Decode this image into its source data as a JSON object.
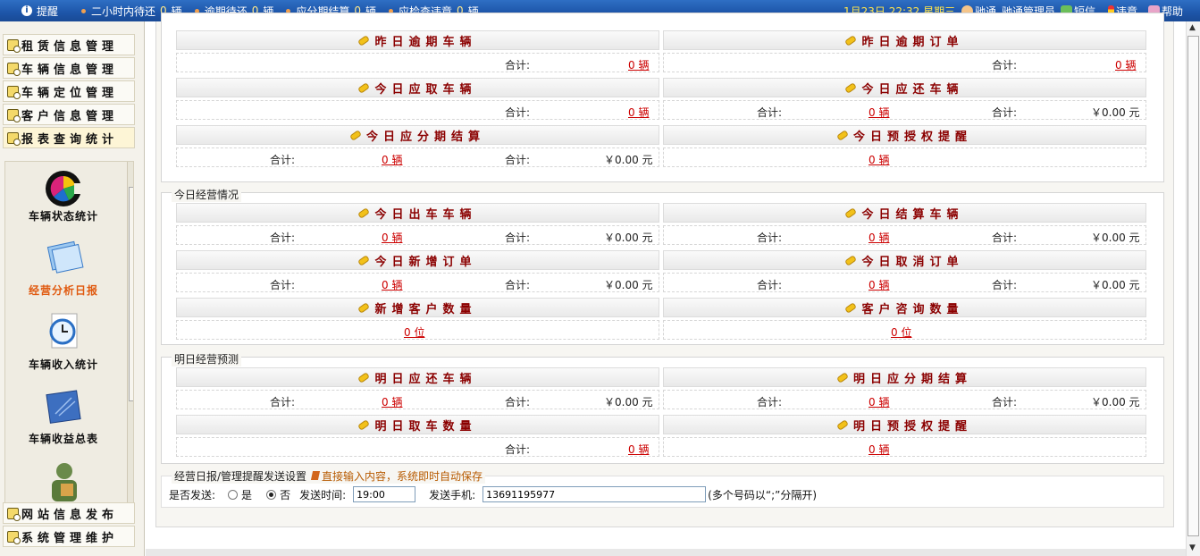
{
  "topbar": {
    "remind": "提醒",
    "items": [
      {
        "label": "二小时内待还",
        "count": "0",
        "unit": "辆"
      },
      {
        "label": "逾期待还",
        "count": "0",
        "unit": "辆"
      },
      {
        "label": "应分期结算",
        "count": "0",
        "unit": "辆"
      },
      {
        "label": "应检查违章",
        "count": "0",
        "unit": "辆"
      }
    ],
    "date": "1月23日  22:32  星期三",
    "company": "驰通",
    "user": "驰通管理员",
    "sms": "短信",
    "violation": "违章",
    "help": "帮助"
  },
  "sidebar": {
    "menus": [
      "租赁信息管理",
      "车辆信息管理",
      "车辆定位管理",
      "客户信息管理",
      "报表查询统计",
      "网站信息发布",
      "系统管理维护"
    ],
    "panel": [
      "车辆状态统计",
      "经营分析日报",
      "车辆收入统计",
      "车辆收益总表"
    ]
  },
  "s1": {
    "h1": "昨日逾期车辆",
    "h2": "昨日逾期订单",
    "h3": "今日应取车辆",
    "h4": "今日应还车辆",
    "h5": "今日应分期结算",
    "h6": "今日预授权提醒"
  },
  "s2": {
    "title": "今日经营情况",
    "h1": "今日出车车辆",
    "h2": "今日结算车辆",
    "h3": "今日新增订单",
    "h4": "今日取消订单",
    "h5": "新增客户数量",
    "h6": "客户咨询数量"
  },
  "s3": {
    "title": "明日经营预测",
    "h1": "明日应还车辆",
    "h2": "明日应分期结算",
    "h3": "明日取车数量",
    "h4": "明日预授权提醒"
  },
  "common": {
    "total": "合计:",
    "car": "0 辆",
    "money": "￥0.00 元",
    "person": "0 位"
  },
  "settings": {
    "title": "经营日报/管理提醒发送设置",
    "tip": "直接输入内容，系统即时自动保存",
    "send_label": "是否发送:",
    "yes": "是",
    "no": "否",
    "time_label": "发送时间:",
    "time_value": "19:00",
    "phone_label": "发送手机:",
    "phone_value": "13691195977",
    "phone_hint": "(多个号码以“;”分隔开)"
  }
}
